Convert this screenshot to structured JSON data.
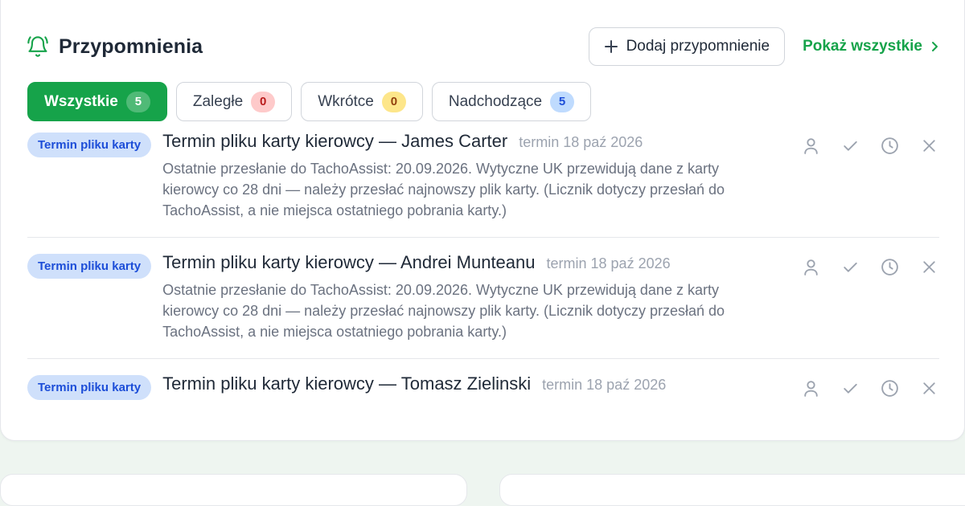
{
  "header": {
    "title": "Przypomnienia",
    "title_icon": "bell-icon",
    "add_button": "Dodaj przypomnienie",
    "add_icon": "plus-icon",
    "show_all": "Pokaż wszystkie",
    "show_all_icon": "chevron-right-icon"
  },
  "filters": [
    {
      "label": "Wszystkie",
      "count": "5",
      "active": true
    },
    {
      "label": "Zaległe",
      "count": "0"
    },
    {
      "label": "Wkrótce",
      "count": "0"
    },
    {
      "label": "Nadchodzące",
      "count": "5"
    }
  ],
  "items": [
    {
      "tag": "Termin pliku karty",
      "title": "Termin pliku karty kierowcy — James Carter",
      "due": "termin 18 paź 2026",
      "description": "Ostatnie przesłanie do TachoAssist: 20.09.2026. Wytyczne UK przewidują dane z karty kierowcy co 28 dni — należy przesłać najnowszy plik karty. (Licznik dotyczy przesłań do TachoAssist, a nie miejsca ostatniego pobrania karty.)"
    },
    {
      "tag": "Termin pliku karty",
      "title": "Termin pliku karty kierowcy — Andrei Munteanu",
      "due": "termin 18 paź 2026",
      "description": "Ostatnie przesłanie do TachoAssist: 20.09.2026. Wytyczne UK przewidują dane z karty kierowcy co 28 dni — należy przesłać najnowszy plik karty. (Licznik dotyczy przesłań do TachoAssist, a nie miejsca ostatniego pobrania karty.)"
    },
    {
      "tag": "Termin pliku karty",
      "title": "Termin pliku karty kierowcy — Tomasz Zielinski",
      "due": "termin 18 paź 2026",
      "description": ""
    }
  ],
  "item_actions": [
    "user-icon",
    "check-icon",
    "clock-icon",
    "close-icon"
  ],
  "colors": {
    "accent": "#16a34a",
    "tag_bg": "#cfe0fb",
    "tag_text": "#1d4ed8",
    "overdue": "#fecaca",
    "soon": "#fde68a",
    "upcoming": "#bfdbfe"
  }
}
